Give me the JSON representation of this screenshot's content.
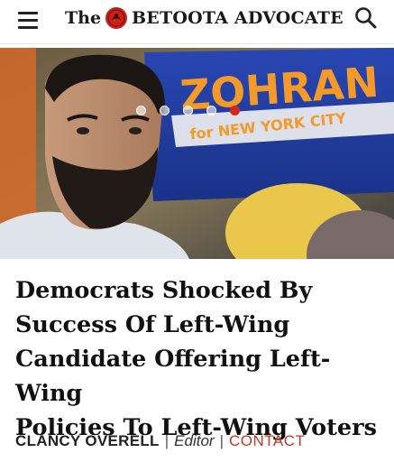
{
  "header": {
    "logo_prefix": "The",
    "logo_name": "BETOOTA ADVOCATE",
    "menu_icon": "hamburger-menu-icon",
    "search_icon": "search-icon"
  },
  "hero": {
    "sign_main": "ZOHRAN",
    "sign_sub": "for NEW YORK CITY",
    "carousel_total": 5,
    "carousel_active": 5
  },
  "article": {
    "headline_lines": [
      "Democrats Shocked By",
      "Success Of Left-Wing",
      "Candidate Offering Left-Wing",
      "Policies To Left-Wing Voters"
    ]
  },
  "byline": {
    "author": "CLANCY OVERELL",
    "separator": "|",
    "role": "Editor",
    "contact_label": "CONTACT"
  },
  "colors": {
    "accent": "#d2281e",
    "contact": "#c0392b",
    "sign_blue": "#1f3fa3",
    "sign_orange": "#f39a2a"
  }
}
